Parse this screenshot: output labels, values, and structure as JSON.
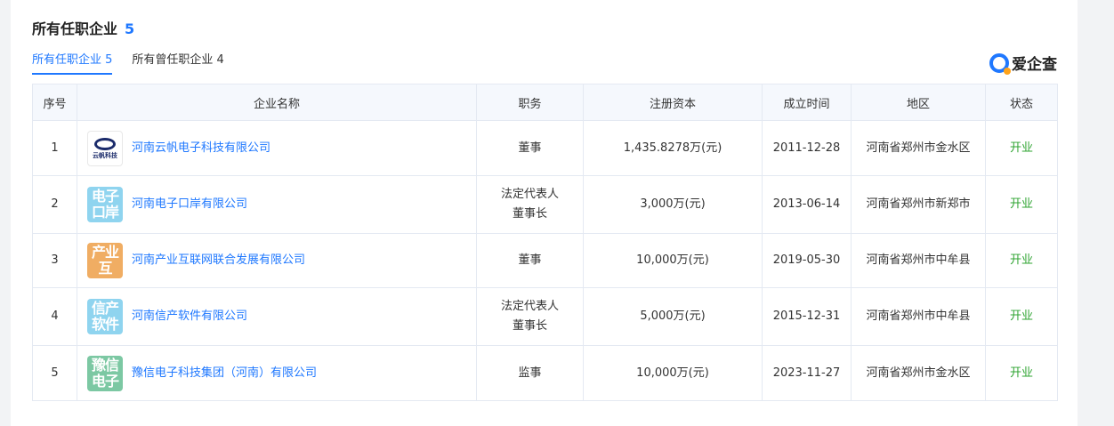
{
  "header": {
    "title": "所有任职企业",
    "count": "5"
  },
  "tabs": [
    {
      "label": "所有任职企业 5"
    },
    {
      "label": "所有曾任职企业 4"
    }
  ],
  "brand": {
    "name": "爱企查"
  },
  "table": {
    "columns": [
      "序号",
      "企业名称",
      "职务",
      "注册资本",
      "成立时间",
      "地区",
      "状态"
    ],
    "rows": [
      {
        "index": "1",
        "logo_text": "云帆科技",
        "logo_color": "#ffffff",
        "name": "河南云帆电子科技有限公司",
        "role1": "董事",
        "role2": "",
        "capital": "1,435.8278万(元)",
        "date": "2011-12-28",
        "region": "河南省郑州市金水区",
        "status": "开业"
      },
      {
        "index": "2",
        "logo_text": "电子口岸",
        "logo_color": "#8fd4ef",
        "name": "河南电子口岸有限公司",
        "role1": "法定代表人",
        "role2": "董事长",
        "capital": "3,000万(元)",
        "date": "2013-06-14",
        "region": "河南省郑州市新郑市",
        "status": "开业"
      },
      {
        "index": "3",
        "logo_text": "产业互",
        "logo_color": "#f0ad63",
        "name": "河南产业互联网联合发展有限公司",
        "role1": "董事",
        "role2": "",
        "capital": "10,000万(元)",
        "date": "2019-05-30",
        "region": "河南省郑州市中牟县",
        "status": "开业"
      },
      {
        "index": "4",
        "logo_text": "信产软件",
        "logo_color": "#8fd4ef",
        "name": "河南信产软件有限公司",
        "role1": "法定代表人",
        "role2": "董事长",
        "capital": "5,000万(元)",
        "date": "2015-12-31",
        "region": "河南省郑州市中牟县",
        "status": "开业"
      },
      {
        "index": "5",
        "logo_text": "豫信电子",
        "logo_color": "#7cc8a3",
        "name": "豫信电子科技集团（河南）有限公司",
        "role1": "监事",
        "role2": "",
        "capital": "10,000万(元)",
        "date": "2023-11-27",
        "region": "河南省郑州市金水区",
        "status": "开业"
      }
    ]
  },
  "colors": {
    "accent": "#1f78ff",
    "status_ok": "#2fa432",
    "header_bg": "#f5f8fd"
  }
}
